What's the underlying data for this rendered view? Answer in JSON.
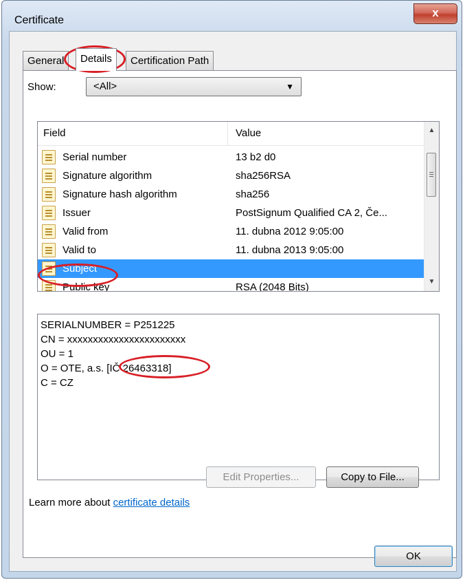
{
  "window": {
    "title": "Certificate",
    "close_label": "x"
  },
  "tabs": [
    "General",
    "Details",
    "Certification Path"
  ],
  "show": {
    "label": "Show:",
    "value": "<All>"
  },
  "list": {
    "headers": {
      "field": "Field",
      "value": "Value"
    },
    "rows": [
      {
        "field": "Serial number",
        "value": "13 b2 d0"
      },
      {
        "field": "Signature algorithm",
        "value": "sha256RSA"
      },
      {
        "field": "Signature hash algorithm",
        "value": "sha256"
      },
      {
        "field": "Issuer",
        "value": "PostSignum Qualified CA 2, Če..."
      },
      {
        "field": "Valid from",
        "value": "11. dubna 2012 9:05:00"
      },
      {
        "field": "Valid to",
        "value": "11. dubna 2013 9:05:00"
      },
      {
        "field": "Subject",
        "value": ""
      },
      {
        "field": "Public key",
        "value": "RSA (2048 Bits)"
      }
    ],
    "selected_index": 6
  },
  "detail": {
    "lines": [
      "SERIALNUMBER = P251225",
      "CN = xxxxxxxxxxxxxxxxxxxxxxx",
      "OU = 1",
      "O = OTE, a.s. [IČ 26463318]",
      "C = CZ"
    ]
  },
  "buttons": {
    "edit_properties": "Edit Properties...",
    "copy_to_file": "Copy to File...",
    "ok": "OK"
  },
  "learn_more": {
    "prefix": "Learn more about ",
    "link": "certificate details"
  },
  "annotation_color": "#d81f26"
}
